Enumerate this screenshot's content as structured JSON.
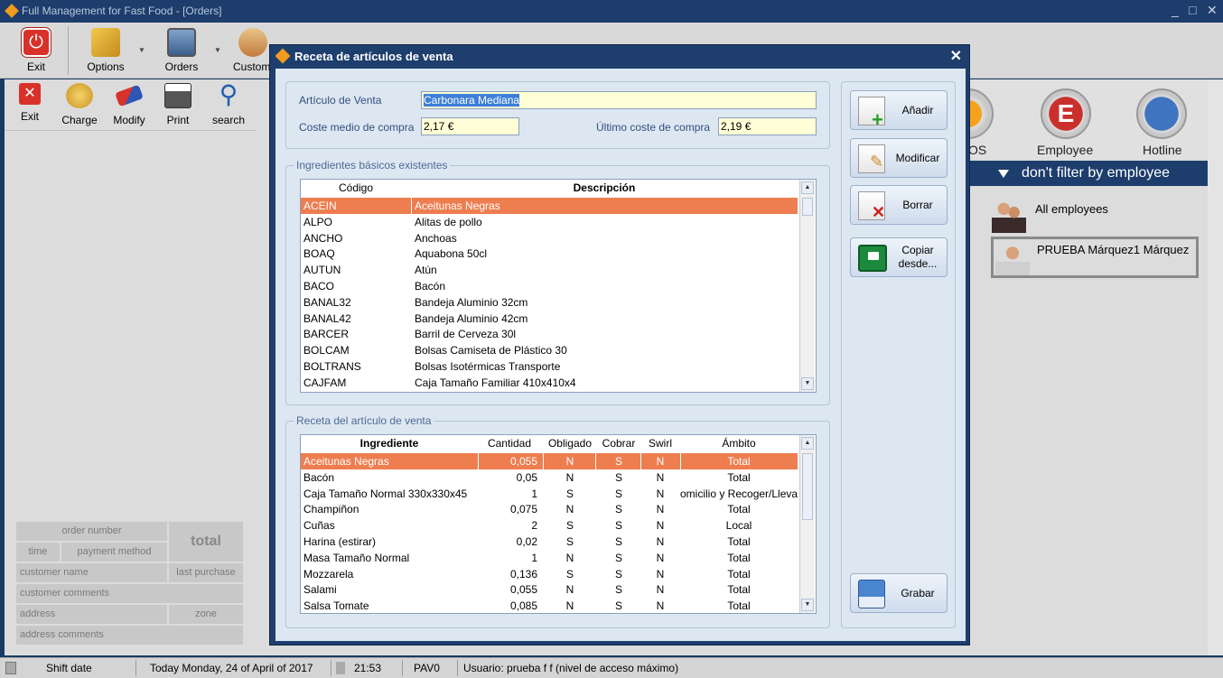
{
  "window": {
    "title": "Full Management for Fast Food - [Orders]"
  },
  "toolbar": {
    "exit": "Exit",
    "options": "Options",
    "orders": "Orders",
    "customers": "Custome"
  },
  "sidebar_toolbar": {
    "exit": "Exit",
    "charge": "Charge",
    "modify": "Modify",
    "print": "Print",
    "search": "search"
  },
  "order_info": {
    "order_number": "order number",
    "total": "total",
    "time": "time",
    "payment_method": "payment method",
    "customer_name": "customer name",
    "last_purchase": "last purchase",
    "customer_comments": "customer comments",
    "address": "address",
    "zone": "zone",
    "address_comments": "address comments"
  },
  "right_panel": {
    "pos_label": "OS",
    "employee_label": "Employee",
    "hotline_label": "Hotline",
    "filter": "don't filter by employee",
    "employees": [
      {
        "name": "All employees"
      },
      {
        "name": "PRUEBA Márquez1 Márquez"
      }
    ]
  },
  "statusbar": {
    "shift_date": "Shift date",
    "today": "Today Monday, 24 of April of 2017",
    "time": "21:53",
    "terminal": "PAV0",
    "user": "Usuario: prueba f f (nivel de acceso máximo)"
  },
  "dialog": {
    "title": "Receta de artículos de venta",
    "articulo_label": "Artículo de Venta",
    "articulo_value": "Carbonara Mediana",
    "coste_medio_label": "Coste medio de compra",
    "coste_medio_value": "2,17 €",
    "ultimo_coste_label": "Último coste de compra",
    "ultimo_coste_value": "2,19 €",
    "ingredientes_group": "Ingredientes básicos existentes",
    "ingredientes_cols": {
      "codigo": "Código",
      "descripcion": "Descripción"
    },
    "ingredientes": [
      {
        "codigo": "ACEIN",
        "descripcion": "Aceitunas Negras"
      },
      {
        "codigo": "ALPO",
        "descripcion": "Alitas de pollo"
      },
      {
        "codigo": "ANCHO",
        "descripcion": "Anchoas"
      },
      {
        "codigo": "BOAQ",
        "descripcion": "Aquabona 50cl"
      },
      {
        "codigo": "AUTUN",
        "descripcion": "Atún"
      },
      {
        "codigo": "BACO",
        "descripcion": "Bacón"
      },
      {
        "codigo": "BANAL32",
        "descripcion": "Bandeja Aluminio 32cm"
      },
      {
        "codigo": "BANAL42",
        "descripcion": "Bandeja Aluminio 42cm"
      },
      {
        "codigo": "BARCER",
        "descripcion": "Barril de Cerveza 30l"
      },
      {
        "codigo": "BOLCAM",
        "descripcion": "Bolsas Camiseta de Plástico 30"
      },
      {
        "codigo": "BOLTRANS",
        "descripcion": "Bolsas Isotérmicas Transporte"
      },
      {
        "codigo": "CAJFAM",
        "descripcion": "Caja Tamaño Familiar 410x410x4"
      }
    ],
    "receta_group": "Receta del artículo de venta",
    "receta_cols": {
      "ingrediente": "Ingrediente",
      "cantidad": "Cantidad",
      "obligado": "Obligado",
      "cobrar": "Cobrar",
      "swirl": "Swirl",
      "ambito": "Ámbito"
    },
    "receta": [
      {
        "ingrediente": "Aceitunas Negras",
        "cantidad": "0,055",
        "obligado": "N",
        "cobrar": "S",
        "swirl": "N",
        "ambito": "Total"
      },
      {
        "ingrediente": "Bacón",
        "cantidad": "0,05",
        "obligado": "N",
        "cobrar": "S",
        "swirl": "N",
        "ambito": "Total"
      },
      {
        "ingrediente": "Caja Tamaño Normal 330x330x45",
        "cantidad": "1",
        "obligado": "S",
        "cobrar": "S",
        "swirl": "N",
        "ambito": "omicilio y Recoger/Llevar"
      },
      {
        "ingrediente": "Champiñon",
        "cantidad": "0,075",
        "obligado": "N",
        "cobrar": "S",
        "swirl": "N",
        "ambito": "Total"
      },
      {
        "ingrediente": "Cuñas",
        "cantidad": "2",
        "obligado": "S",
        "cobrar": "S",
        "swirl": "N",
        "ambito": "Local"
      },
      {
        "ingrediente": "Harina (estirar)",
        "cantidad": "0,02",
        "obligado": "S",
        "cobrar": "S",
        "swirl": "N",
        "ambito": "Total"
      },
      {
        "ingrediente": "Masa Tamaño Normal",
        "cantidad": "1",
        "obligado": "N",
        "cobrar": "S",
        "swirl": "N",
        "ambito": "Total"
      },
      {
        "ingrediente": "Mozzarela",
        "cantidad": "0,136",
        "obligado": "S",
        "cobrar": "S",
        "swirl": "N",
        "ambito": "Total"
      },
      {
        "ingrediente": "Salami",
        "cantidad": "0,055",
        "obligado": "N",
        "cobrar": "S",
        "swirl": "N",
        "ambito": "Total"
      },
      {
        "ingrediente": "Salsa Tomate",
        "cantidad": "0,085",
        "obligado": "N",
        "cobrar": "S",
        "swirl": "N",
        "ambito": "Total"
      }
    ],
    "buttons": {
      "anadir": "Añadir",
      "modificar": "Modificar",
      "borrar": "Borrar",
      "copiar": "Copiar desde...",
      "grabar": "Grabar"
    }
  }
}
